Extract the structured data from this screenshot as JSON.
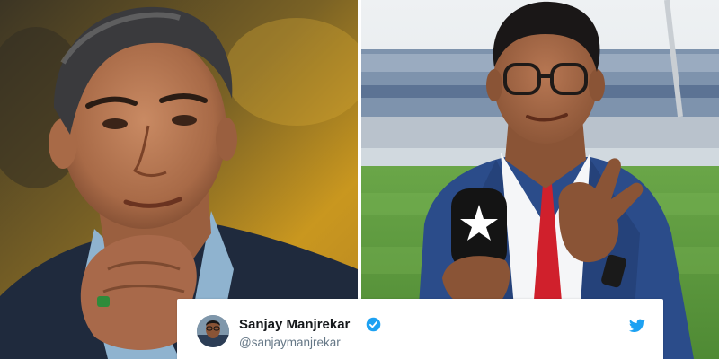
{
  "tweet": {
    "display_name": "Sanjay Manjrekar",
    "handle": "@sanjaymanjrekar"
  },
  "icons": {
    "verified": "verified-badge-icon",
    "brand": "twitter-bird-icon",
    "mic_logo": "star-logo-icon"
  },
  "colors": {
    "verified_blue": "#1da1f2",
    "twitter_blue": "#1da1f2",
    "name_text": "#14171a",
    "handle_text": "#657786",
    "pitch_green": "#5f9a3f",
    "blazer_blue": "#2b4c8a",
    "tie_red": "#d0202c"
  }
}
